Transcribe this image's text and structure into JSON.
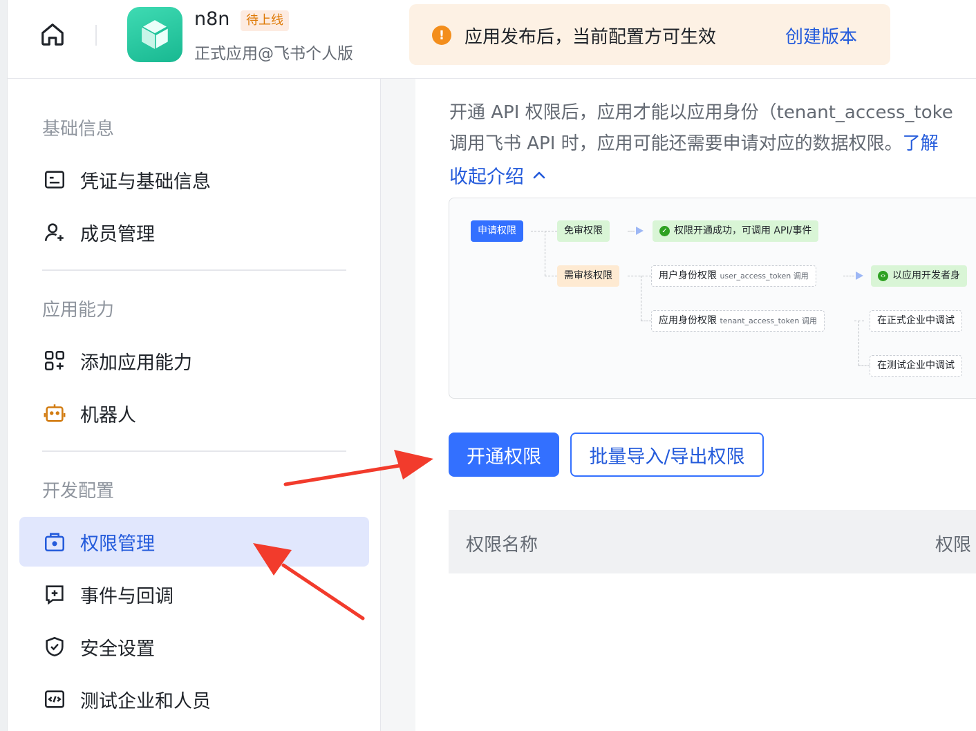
{
  "header": {
    "app_name": "n8n",
    "status_badge": "待上线",
    "app_subtitle": "正式应用@飞书个人版",
    "notice_text": "应用发布后，当前配置方可生效",
    "notice_link": "创建版本"
  },
  "sidebar": {
    "sections": [
      {
        "title": "基础信息"
      },
      {
        "title": "应用能力"
      },
      {
        "title": "开发配置"
      }
    ],
    "items": [
      {
        "label": "凭证与基础信息",
        "icon": "credential-icon"
      },
      {
        "label": "成员管理",
        "icon": "add-member-icon"
      },
      {
        "label": "添加应用能力",
        "icon": "add-capability-icon"
      },
      {
        "label": "机器人",
        "icon": "robot-icon"
      },
      {
        "label": "权限管理",
        "icon": "permission-bag-icon",
        "active": true
      },
      {
        "label": "事件与回调",
        "icon": "event-icon"
      },
      {
        "label": "安全设置",
        "icon": "shield-icon"
      },
      {
        "label": "测试企业和人员",
        "icon": "code-box-icon"
      }
    ]
  },
  "main": {
    "intro_line1": "开通 API 权限后，应用才能以应用身份（tenant_access_toke",
    "intro_line2": "调用飞书 API 时，应用可能还需要申请对应的数据权限。",
    "intro_link": "了解",
    "collapse_label": "收起介绍",
    "diagram": {
      "apply": "申请权限",
      "no_review": "免审权限",
      "success": "权限开通成功，可调用 API/事件",
      "need_review": "需审核权限",
      "user_perm": "用户身份权限",
      "user_token": "user_access_token 调用",
      "dev_identity": "以应用开发者身",
      "app_perm": "应用身份权限",
      "tenant_token": "tenant_access_token 调用",
      "prod_debug": "在正式企业中调试",
      "test_debug": "在测试企业中调试"
    },
    "primary_button": "开通权限",
    "outline_button": "批量导入/导出权限",
    "table_headers": [
      "权限名称",
      "权限"
    ]
  },
  "colors": {
    "accent": "#3370ff",
    "link": "#245bdb",
    "active_bg": "#e1e7fd",
    "notice_bg": "#fdf1e4",
    "warning": "#f38e1c",
    "annotation_arrow": "#f23b2c"
  }
}
